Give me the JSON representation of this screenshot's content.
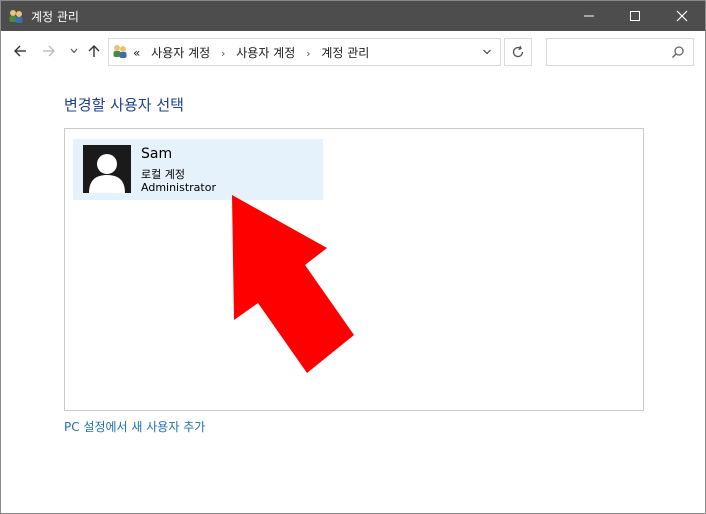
{
  "window": {
    "title": "계정 관리",
    "title_bar_color": "#4d4d4d"
  },
  "nav": {
    "back_icon": "arrow-left-icon",
    "forward_icon": "arrow-right-icon",
    "recent_icon": "chevron-down-icon",
    "up_icon": "arrow-up-icon",
    "breadcrumb_overflow": "«",
    "breadcrumbs": [
      "사용자 계정",
      "사용자 계정",
      "계정 관리"
    ],
    "refresh_icon": "refresh-icon",
    "search_placeholder": ""
  },
  "content": {
    "heading": "변경할 사용자 선택",
    "heading_color": "#1e3f8f",
    "users": [
      {
        "name": "Sam",
        "type": "로컬 계정",
        "role": "Administrator"
      }
    ],
    "add_user_link": "PC 설정에서 새 사용자 추가",
    "link_color": "#1f6fb2",
    "annotation_arrow_color": "#ff0000"
  }
}
